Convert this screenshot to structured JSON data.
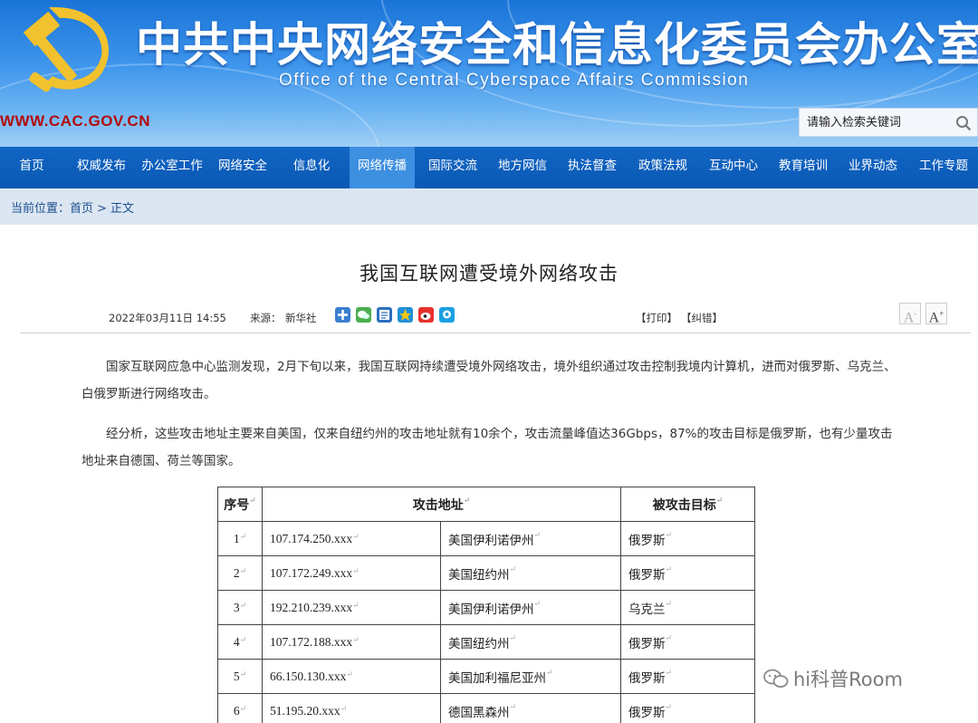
{
  "header": {
    "title_cn": "中共中央网络安全和信息化委员会办公室",
    "title_en": "Office of the Central Cyberspace Affairs Commission",
    "domain": "WWW.CAC.GOV.CN",
    "search_placeholder": "请输入检索关键词"
  },
  "nav": {
    "items": [
      {
        "label": "首页"
      },
      {
        "label": "权威发布"
      },
      {
        "label": "办公室工作"
      },
      {
        "label": "网络安全"
      },
      {
        "label": "信息化"
      },
      {
        "label": "网络传播"
      },
      {
        "label": "国际交流"
      },
      {
        "label": "地方网信"
      },
      {
        "label": "执法督查"
      },
      {
        "label": "政策法规"
      },
      {
        "label": "互动中心"
      },
      {
        "label": "教育培训"
      },
      {
        "label": "业界动态"
      },
      {
        "label": "工作专题"
      }
    ],
    "active_index": 5
  },
  "breadcrumb": {
    "prefix": "当前位置：",
    "home": "首页",
    "separator": ">",
    "current": "正文"
  },
  "article": {
    "title": "我国互联网遭受境外网络攻击",
    "date": "2022年03月11日 14:55",
    "source_label": "来源：",
    "source": "新华社",
    "print": "【打印】",
    "correct": "【纠错】",
    "font_larger": "A",
    "font_smaller": "A",
    "paragraphs": [
      "国家互联网应急中心监测发现，2月下旬以来，我国互联网持续遭受境外网络攻击，境外组织通过攻击控制我境内计算机，进而对俄罗斯、乌克兰、白俄罗斯进行网络攻击。",
      "经分析，这些攻击地址主要来自美国，仅来自纽约州的攻击地址就有10余个，攻击流量峰值达36Gbps，87%的攻击目标是俄罗斯，也有少量攻击地址来自德国、荷兰等国家。"
    ]
  },
  "table": {
    "headers": [
      "序号",
      "攻击地址",
      "被攻击目标"
    ],
    "rows": [
      {
        "no": "1",
        "ip": "107.174.250.xxx",
        "loc": "美国伊利诺伊州",
        "target": "俄罗斯"
      },
      {
        "no": "2",
        "ip": "107.172.249.xxx",
        "loc": "美国纽约州",
        "target": "俄罗斯"
      },
      {
        "no": "3",
        "ip": "192.210.239.xxx",
        "loc": "美国伊利诺伊州",
        "target": "乌克兰"
      },
      {
        "no": "4",
        "ip": "107.172.188.xxx",
        "loc": "美国纽约州",
        "target": "俄罗斯"
      },
      {
        "no": "5",
        "ip": "66.150.130.xxx",
        "loc": "美国加利福尼亚州",
        "target": "俄罗斯"
      },
      {
        "no": "6",
        "ip": "51.195.20.xxx",
        "loc": "德国黑森州",
        "target": "俄罗斯"
      }
    ]
  },
  "watermark": "hi科普Room",
  "colors": {
    "nav_bg": "#0a58b4",
    "nav_active": "#3d8fe0",
    "breadcrumb_bg": "#dbe6f2",
    "domain_red": "#b30a0a",
    "emblem_gold": "#f2c12e"
  }
}
